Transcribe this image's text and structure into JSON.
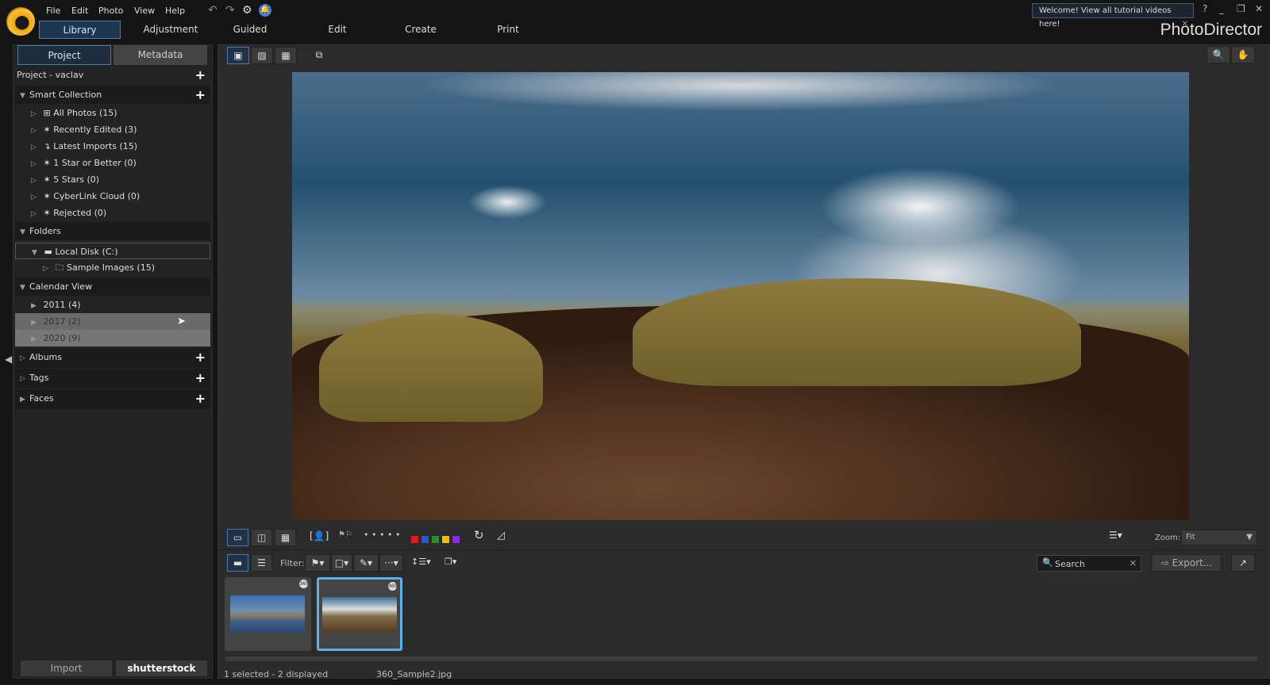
{
  "menu": [
    "File",
    "Edit",
    "Photo",
    "View",
    "Help"
  ],
  "modules": [
    "Library",
    "Adjustment",
    "Guided",
    "Edit",
    "Create",
    "Print"
  ],
  "tooltip": "Welcome! View all tutorial videos here!",
  "brand": "PhotoDirector",
  "window_controls": [
    "?",
    "_",
    "❐",
    "✕"
  ],
  "left_panel": {
    "tabs": [
      "Project",
      "Metadata"
    ],
    "project_title": "Project - vaclav",
    "smart_collection": {
      "label": "Smart Collection",
      "items": [
        "All Photos (15)",
        "Recently Edited (3)",
        "Latest Imports (15)",
        "1 Star or Better (0)",
        "5 Stars (0)",
        "CyberLink Cloud (0)",
        "Rejected (0)"
      ]
    },
    "folders": {
      "label": "Folders",
      "items": [
        "Local Disk (C:)",
        "Sample Images (15)"
      ]
    },
    "calendar": {
      "label": "Calendar View",
      "items": [
        "2011 (4)",
        "2017 (2)",
        "2020 (9)"
      ]
    },
    "albums": "Albums",
    "tags": "Tags",
    "faces": "Faces",
    "import_label": "Import",
    "shutterstock_label": "shutterstock"
  },
  "viewer": {
    "zoom_label": "Zoom:",
    "zoom_value": "Fit",
    "color_labels": [
      "#e01b1b",
      "#2a55d6",
      "#2e8b2e",
      "#f0c000",
      "#8a2be2"
    ],
    "stars": "• • • • •"
  },
  "filter": {
    "label": "Filter:",
    "search_placeholder": "Search",
    "export_label": "Export..."
  },
  "thumbnails": [
    {
      "badge": "360"
    },
    {
      "badge": "360",
      "selected": true
    }
  ],
  "status": {
    "selection": "1 selected - 2 displayed",
    "filename": "360_Sample2.jpg"
  }
}
